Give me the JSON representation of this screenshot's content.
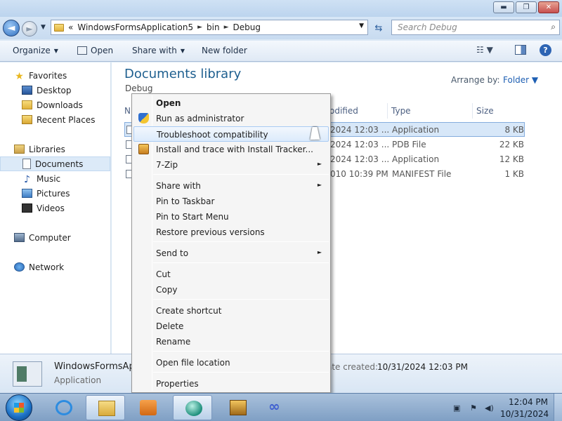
{
  "window": {
    "buttons": {
      "minimize": "▬",
      "maximize": "❐",
      "close": "✕"
    }
  },
  "nav": {
    "back": "◄",
    "forward": "►",
    "history": "▼",
    "address": {
      "overflow": "«",
      "crumbs": [
        "WindowsFormsApplication5",
        "bin",
        "Debug"
      ],
      "separator": "►",
      "dropdown": "▼"
    },
    "refresh": "⇆",
    "search_placeholder": "Search Debug",
    "search_icon": "⌕"
  },
  "toolbar": {
    "organize": "Organize",
    "open": "Open",
    "share_with": "Share with",
    "new_folder": "New folder",
    "arrow": "▼",
    "views": "☷ ▼",
    "help": "?"
  },
  "navpane": {
    "favorites": "Favorites",
    "desktop": "Desktop",
    "downloads": "Downloads",
    "recent_places": "Recent Places",
    "libraries": "Libraries",
    "documents": "Documents",
    "music": "Music",
    "pictures": "Pictures",
    "videos": "Videos",
    "computer": "Computer",
    "network": "Network"
  },
  "content": {
    "title": "Documents library",
    "subtitle": "Debug",
    "arrange_label": "Arrange by:",
    "arrange_value": "Folder ▼",
    "columns": {
      "name": "N",
      "modified": "odified",
      "type": "Type",
      "size": "Size"
    },
    "rows": [
      {
        "modified": "2024 12:03 ...",
        "type": "Application",
        "size": "8 KB"
      },
      {
        "modified": "2024 12:03 ...",
        "type": "PDB File",
        "size": "22 KB"
      },
      {
        "modified": "2024 12:03 ...",
        "type": "Application",
        "size": "12 KB"
      },
      {
        "modified": "010 10:39 PM",
        "type": "MANIFEST File",
        "size": "1 KB"
      }
    ]
  },
  "details": {
    "name": "WindowsFormsApp",
    "type": "Application",
    "date_label": "ate created:",
    "date_value": "10/31/2024 12:03 PM"
  },
  "context_menu": {
    "open": "Open",
    "run_as_admin": "Run as administrator",
    "troubleshoot": "Troubleshoot compatibility",
    "install_tracker": "Install and trace with Install Tracker...",
    "seven_zip": "7-Zip",
    "share_with": "Share with",
    "pin_taskbar": "Pin to Taskbar",
    "pin_start": "Pin to Start Menu",
    "restore_versions": "Restore previous versions",
    "send_to": "Send to",
    "cut": "Cut",
    "copy": "Copy",
    "create_shortcut": "Create shortcut",
    "delete": "Delete",
    "rename": "Rename",
    "open_location": "Open file location",
    "properties": "Properties",
    "submenu_arrow": "►"
  },
  "taskbar": {
    "infinity": "∞",
    "tray": {
      "network": "▣",
      "flag": "⚑",
      "volume": "◀)"
    },
    "clock_time": "12:04 PM",
    "clock_date": "10/31/2024"
  }
}
